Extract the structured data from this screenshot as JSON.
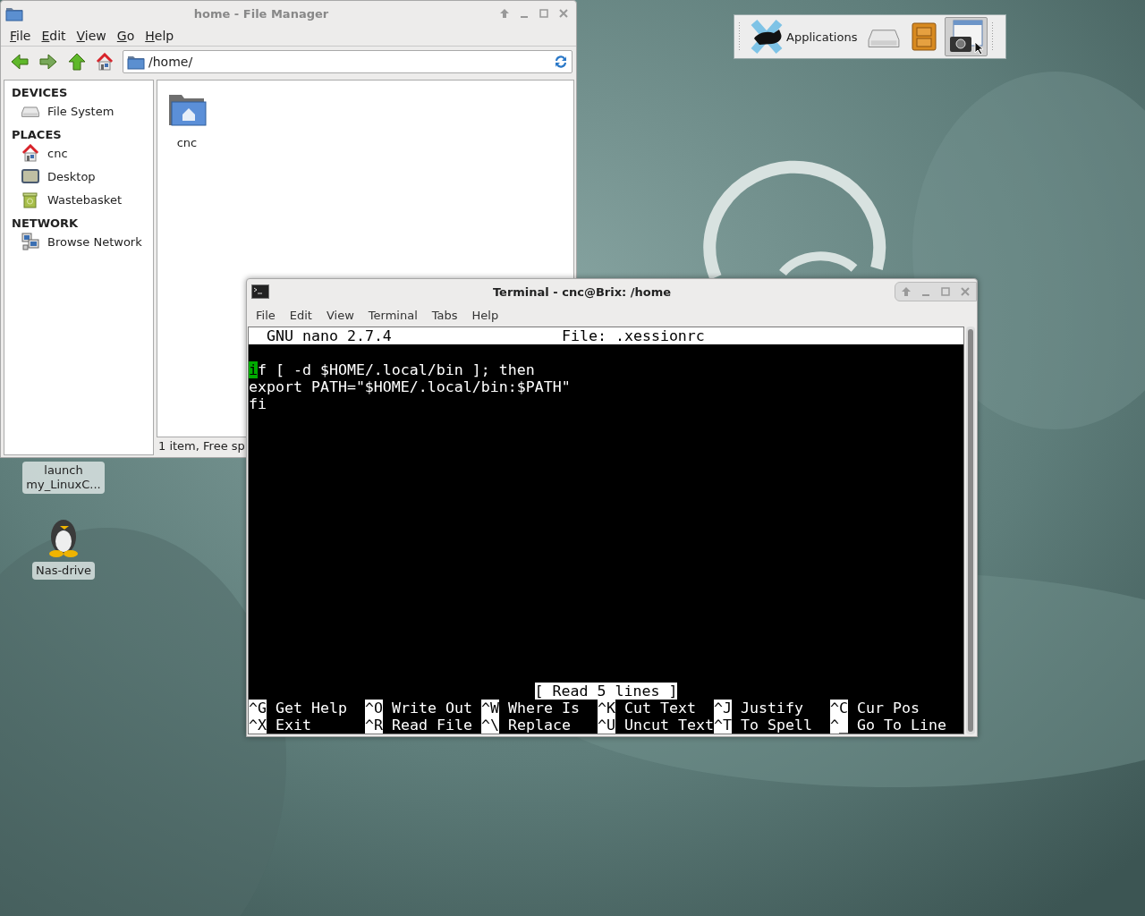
{
  "desktop": {
    "icons": [
      {
        "label": "launch my_LinuxC...",
        "kind": "launcher"
      },
      {
        "label": "Nas-drive",
        "kind": "penguin"
      }
    ]
  },
  "panel": {
    "items": [
      {
        "kind": "menu",
        "label": "Applications",
        "selected": false
      },
      {
        "kind": "drive",
        "selected": false
      },
      {
        "kind": "cabinet",
        "selected": false
      },
      {
        "kind": "screenshot",
        "selected": true
      }
    ]
  },
  "file_manager": {
    "window": {
      "title": "home - File Manager",
      "active": false
    },
    "menu": [
      "File",
      "Edit",
      "View",
      "Go",
      "Help"
    ],
    "location": "/home/",
    "sidebar": {
      "sections": [
        {
          "heading": "DEVICES",
          "items": [
            {
              "label": "File System",
              "kind": "drive"
            }
          ]
        },
        {
          "heading": "PLACES",
          "items": [
            {
              "label": "cnc",
              "kind": "home"
            },
            {
              "label": "Desktop",
              "kind": "desktop"
            },
            {
              "label": "Wastebasket",
              "kind": "trash"
            }
          ]
        },
        {
          "heading": "NETWORK",
          "items": [
            {
              "label": "Browse Network",
              "kind": "network"
            }
          ]
        }
      ]
    },
    "items": [
      {
        "label": "cnc",
        "kind": "home-folder"
      }
    ],
    "status_bar": "1 item, Free sp"
  },
  "terminal": {
    "window": {
      "title": "Terminal - cnc@Brix: /home",
      "active": true
    },
    "menu": [
      "File",
      "Edit",
      "View",
      "Terminal",
      "Tabs",
      "Help"
    ],
    "nano": {
      "version": "GNU nano 2.7.4",
      "file": "File: .xessionrc",
      "lines": [
        {
          "text": "if [ -d $HOME/.local/bin ]; then",
          "cursor": true
        },
        {
          "text": "export PATH=\"$HOME/.local/bin:$PATH\"",
          "cursor": false
        },
        {
          "text": "fi",
          "cursor": false
        }
      ],
      "status": "[ Read 5 lines ]",
      "shortcuts": [
        {
          "key": "^G",
          "label": "Get Help"
        },
        {
          "key": "^O",
          "label": "Write Out"
        },
        {
          "key": "^W",
          "label": "Where Is"
        },
        {
          "key": "^K",
          "label": "Cut Text"
        },
        {
          "key": "^J",
          "label": "Justify"
        },
        {
          "key": "^C",
          "label": "Cur Pos"
        },
        {
          "key": "^X",
          "label": "Exit"
        },
        {
          "key": "^R",
          "label": "Read File"
        },
        {
          "key": "^\\",
          "label": "Replace"
        },
        {
          "key": "^U",
          "label": "Uncut Text"
        },
        {
          "key": "^T",
          "label": "To Spell"
        },
        {
          "key": "^_",
          "label": "Go To Line"
        }
      ]
    }
  }
}
